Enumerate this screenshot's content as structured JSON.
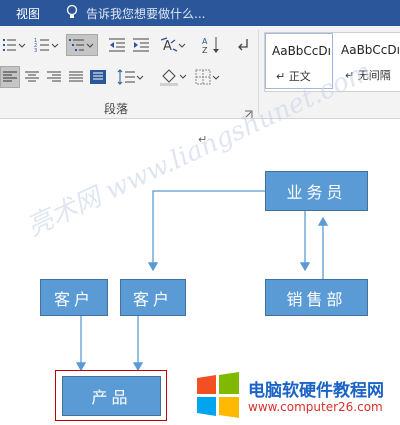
{
  "topbar": {
    "tab_view": "视图",
    "tellme_placeholder": "告诉我您想要做什么..."
  },
  "ribbon": {
    "paragraph_group_label": "段落",
    "styles": [
      {
        "sample": "AaBbCcDı",
        "name": "正文"
      },
      {
        "sample": "AaBbCcDı",
        "name": "无间隔"
      }
    ]
  },
  "document": {
    "paragraph_mark": "↵",
    "nodes": {
      "salesman": "业务员",
      "customer_1": "客户",
      "customer_2": "客户",
      "sales_dept": "销售部",
      "product": "产品"
    },
    "watermark": "亮术网 www.liangshunet.com"
  },
  "logo": {
    "title": "电脑软硬件教程网",
    "url": "www.computer26.com"
  },
  "colors": {
    "title_bar": "#2b579a",
    "node_fill": "#5b9bd5",
    "connector": "#5b9bd5",
    "selection_frame": "#c00000"
  }
}
